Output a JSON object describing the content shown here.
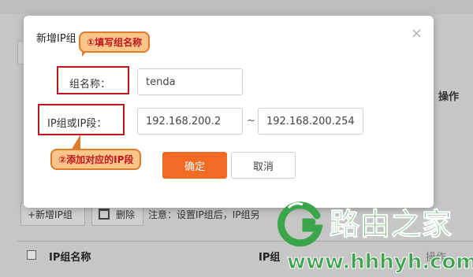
{
  "modal": {
    "title": "新增IP组",
    "close_glyph": "×",
    "group_name_label": "组名称：",
    "group_name_value": "tenda",
    "ip_label": "IP组或IP段：",
    "ip_start_value": "192.168.200.2",
    "ip_separator": "~",
    "ip_end_value": "192.168.200.254",
    "ok_label": "确定",
    "cancel_label": "取消"
  },
  "callouts": {
    "step1": "①填写组名称",
    "step2": "②添加对应的IP段"
  },
  "background": {
    "operation_header": "操作",
    "add_button": "+新增IP组",
    "delete_button": "删除",
    "note": "注意：设置IP组后，IP组另",
    "table_col_name": "IP组名称",
    "table_col_ip": "IP组",
    "table_col_op": "操作"
  },
  "watermark": {
    "brand": "路由之家",
    "url": "www.hhhyh.com",
    "color": "#3aa54b"
  },
  "colors": {
    "accent_orange": "#f26b25",
    "highlight_red": "#c0161d",
    "callout_fill": "#fbc58a"
  }
}
